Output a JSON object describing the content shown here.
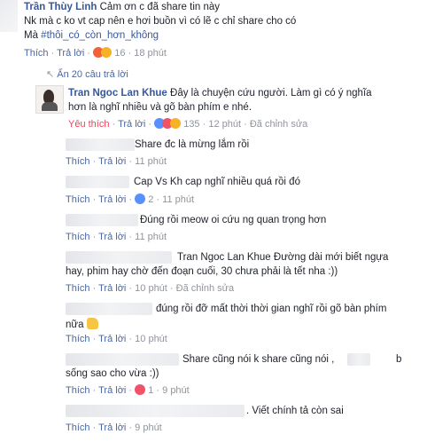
{
  "top_comment": {
    "author": "Trần Thùy Linh",
    "text_1": "Cảm ơn c đã share tin này",
    "text_2": "Nk mà c ko vt cap nên e hơi buồn vì có lẽ c chỉ share cho có",
    "text_3_prefix": "Mà ",
    "hashtag": "#thôi_có_còn_hơn_không",
    "like": "Thích",
    "reply": "Trả lời",
    "reaction_count": "16",
    "time": "18 phút",
    "reactions": [
      "angry-icon",
      "haha-icon"
    ]
  },
  "hidden_replies": {
    "label": "Ẩn 20 câu trả lời"
  },
  "main_reply": {
    "author": "Tran Ngoc Lan Khue",
    "text_1": "Đây là chuyện cứu người. Làm gì có ý nghĩa",
    "text_2": "hơn là nghĩ nhiều và gõ bàn phím e nhé.",
    "liked": "Yêu thích",
    "reply": "Trả lời",
    "reaction_count": "135",
    "time": "12 phút",
    "edited": "Đã chỉnh sửa",
    "colors": {
      "liked": "#f33e58"
    }
  },
  "replies": [
    {
      "text": "Share đc là mừng lắm rồi",
      "like": "Thích",
      "reply": "Trả lời",
      "time": "11 phút",
      "reactions": ""
    },
    {
      "text": "Cap Vs Kh cap nghĩ nhiều quá rồi đó",
      "like": "Thích",
      "reply": "Trả lời",
      "count": "2",
      "time": "11 phút"
    },
    {
      "text": "Đúng rồi meow oi cứu ng quan trọng hơn",
      "like": "Thích",
      "reply": "Trả lời",
      "time": "11 phút"
    },
    {
      "text_1": "Tran Ngoc Lan Khue Đường dài mới biết ngựa",
      "text_2": "hay, phim hay chờ đến đoạn cuối, 30 chưa phải là tết nha :))",
      "like": "Thích",
      "reply": "Trả lời",
      "time": "10 phút",
      "edited": "Đã chỉnh sửa"
    },
    {
      "text_1": "đúng rồi đỡ mất thời thời gian nghĩ rồi gõ bàn phím",
      "text_2": "nữa",
      "like": "Thích",
      "reply": "Trả lời",
      "time": "10 phút"
    },
    {
      "text_1": "Share cũng nói k share cũng nói ,",
      "text_1b": "b",
      "text_2": "sống sao cho vừa :))",
      "like": "Thích",
      "reply": "Trả lời",
      "count": "1",
      "time": "9 phút"
    },
    {
      "text": ". Viết chính tả còn sai",
      "like": "Thích",
      "reply": "Trả lời",
      "time": "9 phút"
    }
  ],
  "separator": "·"
}
